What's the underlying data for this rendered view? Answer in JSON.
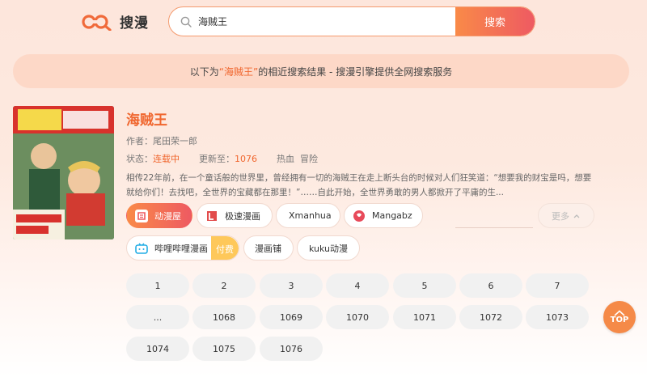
{
  "header": {
    "logo_text": "搜漫",
    "search": {
      "value": "海贼王",
      "button_label": "搜索"
    },
    "accent_color": "#f0662e"
  },
  "notice": {
    "prefix": "以下为",
    "keyword": "“海贼王”",
    "suffix": "的相近搜索结果 - 搜漫引擎提供全网搜索服务"
  },
  "comic": {
    "title": "海贼王",
    "author_label": "作者：",
    "author": "尾田荣一郎",
    "status_label": "状态：",
    "status": "连载中",
    "update_label": "更新至：",
    "latest": "1076",
    "tags": "热血  冒险",
    "description": "相传22年前，在一个童话般的世界里，曾经拥有一切的海贼王在走上断头台的时候对人们狂笑道：“想要我的财宝是吗，想要就给你们！去找吧，全世界的宝藏都在那里！”……自此开始，全世界勇敢的男人都掀开了平庸的生..."
  },
  "sources": [
    {
      "label": "动漫屋",
      "icon": "dongmanwu-icon",
      "active": true
    },
    {
      "label": "极速漫画",
      "icon": "jisu-icon",
      "active": false
    },
    {
      "label": "Xmanhua",
      "icon": "",
      "active": false
    },
    {
      "label": "Mangabz",
      "icon": "mangabz-icon",
      "active": false
    },
    {
      "label": "哔哩哔哩漫画",
      "icon": "bilibili-icon",
      "active": false,
      "badge": "付费"
    },
    {
      "label": "漫画铺",
      "icon": "",
      "active": false
    },
    {
      "label": "kuku动漫",
      "icon": "",
      "active": false
    }
  ],
  "more_label": "更多",
  "chapters": [
    "1",
    "2",
    "3",
    "4",
    "5",
    "6",
    "7",
    "...",
    "1068",
    "1069",
    "1070",
    "1071",
    "1072",
    "1073",
    "1074",
    "1075",
    "1076"
  ],
  "top_button_label": "TOP"
}
